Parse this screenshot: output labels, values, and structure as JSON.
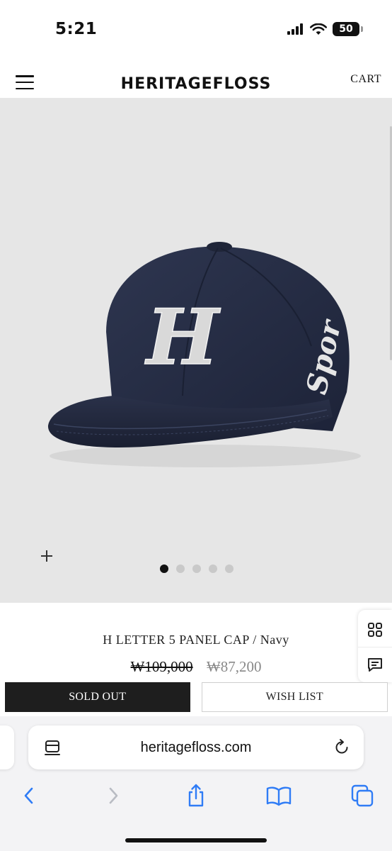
{
  "status_bar": {
    "time": "5:21",
    "battery_level": "50",
    "icons": [
      "signal-icon",
      "wifi-icon",
      "battery-icon"
    ]
  },
  "header": {
    "brand": "HERITAGEFLOSS",
    "cart_label": "CART",
    "menu_icon": "hamburger-menu-icon"
  },
  "gallery": {
    "image": "navy-cap-photo",
    "embroidered_letter": "H",
    "side_script_text": "Spor",
    "slide_count": 5,
    "active_slide": 1,
    "zoom_icon": "plus-icon",
    "background_color": "#e6e6e6",
    "cap_color": "#242c44"
  },
  "product": {
    "name": "H LETTER 5 PANEL CAP / Navy",
    "original_price": "₩109,000",
    "sale_price": "₩87,200"
  },
  "side_tools": {
    "icons": [
      "grid-icon",
      "chat-icon"
    ]
  },
  "actions": {
    "sold_out_label": "SOLD OUT",
    "wish_list_label": "WISH LIST"
  },
  "browser": {
    "url": "heritagefloss.com",
    "icons": [
      "page-settings-icon",
      "reload-icon",
      "back-icon",
      "forward-icon",
      "share-icon",
      "bookmarks-icon",
      "tabs-icon"
    ]
  }
}
